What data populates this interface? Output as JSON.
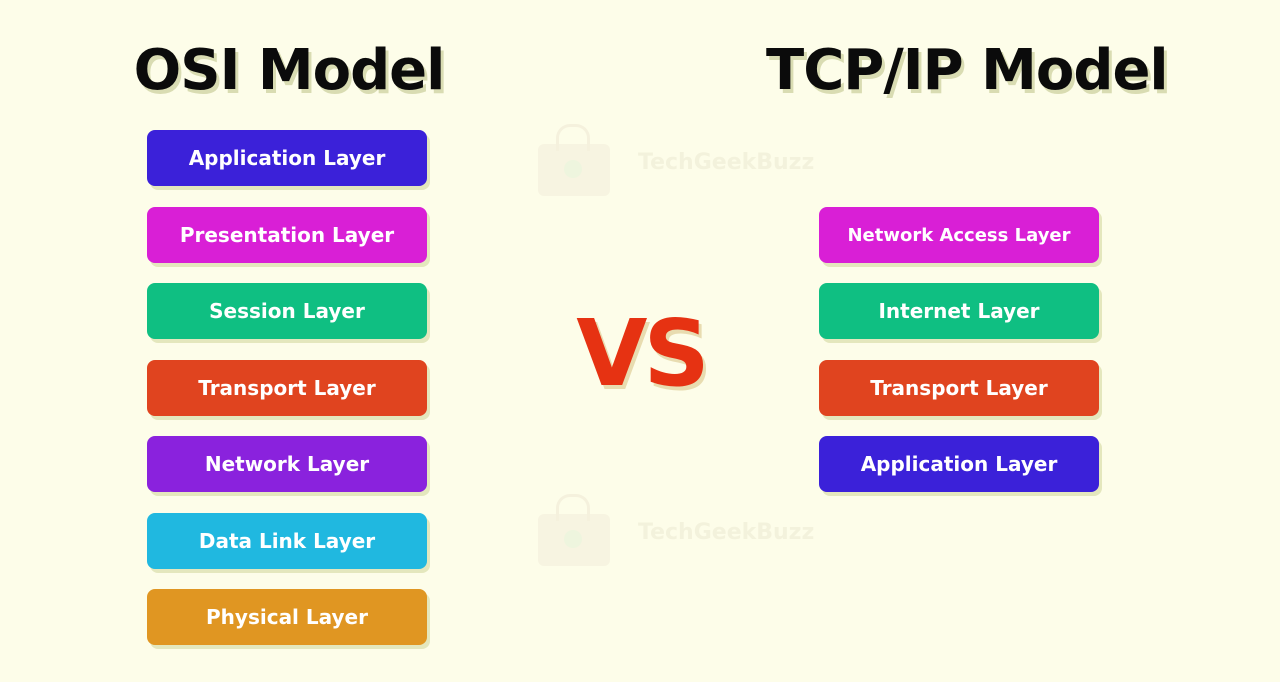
{
  "osi": {
    "title": "OSI Model",
    "layers": [
      {
        "label": "Application Layer",
        "color": "#3b21d9"
      },
      {
        "label": "Presentation Layer",
        "color": "#d91fd6"
      },
      {
        "label": "Session Layer",
        "color": "#0fbf82"
      },
      {
        "label": "Transport Layer",
        "color": "#e0441f"
      },
      {
        "label": "Network Layer",
        "color": "#8a22dd"
      },
      {
        "label": "Data Link Layer",
        "color": "#20b8e0"
      },
      {
        "label": "Physical Layer",
        "color": "#e09622"
      }
    ]
  },
  "vs": {
    "label": "VS",
    "color": "#e63212"
  },
  "tcp": {
    "title": "TCP/IP Model",
    "layers": [
      {
        "label": "Network Access Layer",
        "color": "#d91fd6"
      },
      {
        "label": "Internet Layer",
        "color": "#0fbf82"
      },
      {
        "label": "Transport Layer",
        "color": "#e0441f"
      },
      {
        "label": "Application Layer",
        "color": "#3b21d9"
      }
    ]
  },
  "watermark": {
    "text": "TechGeekBuzz",
    "icon": "bag-logo-icon"
  }
}
